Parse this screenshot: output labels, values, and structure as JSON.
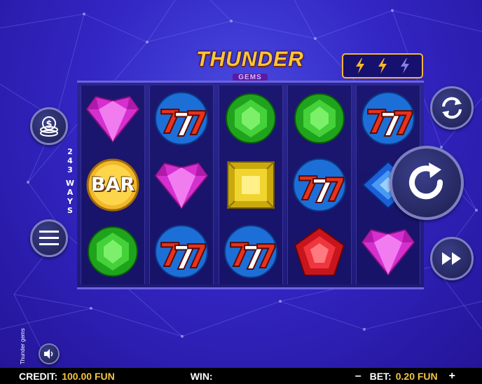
{
  "game": {
    "logo_line1": "THUNDER",
    "logo_line2": "GEMS",
    "vertical_name": "Thunder gems",
    "bolts": 3
  },
  "ways": {
    "number": [
      "2",
      "4",
      "3"
    ],
    "word": [
      "W",
      "A",
      "Y",
      "S"
    ]
  },
  "reels": [
    [
      "heart-pink",
      "bar",
      "round-green"
    ],
    [
      "sevens",
      "heart-pink",
      "sevens"
    ],
    [
      "round-green",
      "square-yellow",
      "sevens"
    ],
    [
      "round-green",
      "sevens",
      "pentagon-red"
    ],
    [
      "sevens",
      "diamond-blue",
      "heart-pink"
    ]
  ],
  "bar_text": "BAR",
  "bottom_bar": {
    "credit_label": "CREDIT:",
    "credit_value": "100.00 FUN",
    "win_label": "WIN:",
    "win_value": "",
    "minus": "–",
    "bet_label": "BET:",
    "bet_value": "0.20 FUN",
    "plus": "+"
  },
  "colors": {
    "background": "#3326c4",
    "reel_frame": "#6b63e0",
    "accent_gold": "#f4c542",
    "bottom_bar": "#000000"
  },
  "icons": {
    "coins": "coins-icon",
    "menu": "menu-icon",
    "sound": "speaker-icon",
    "autoplay": "autoplay-icon",
    "spin": "spin-icon",
    "turbo": "fast-forward-icon"
  }
}
